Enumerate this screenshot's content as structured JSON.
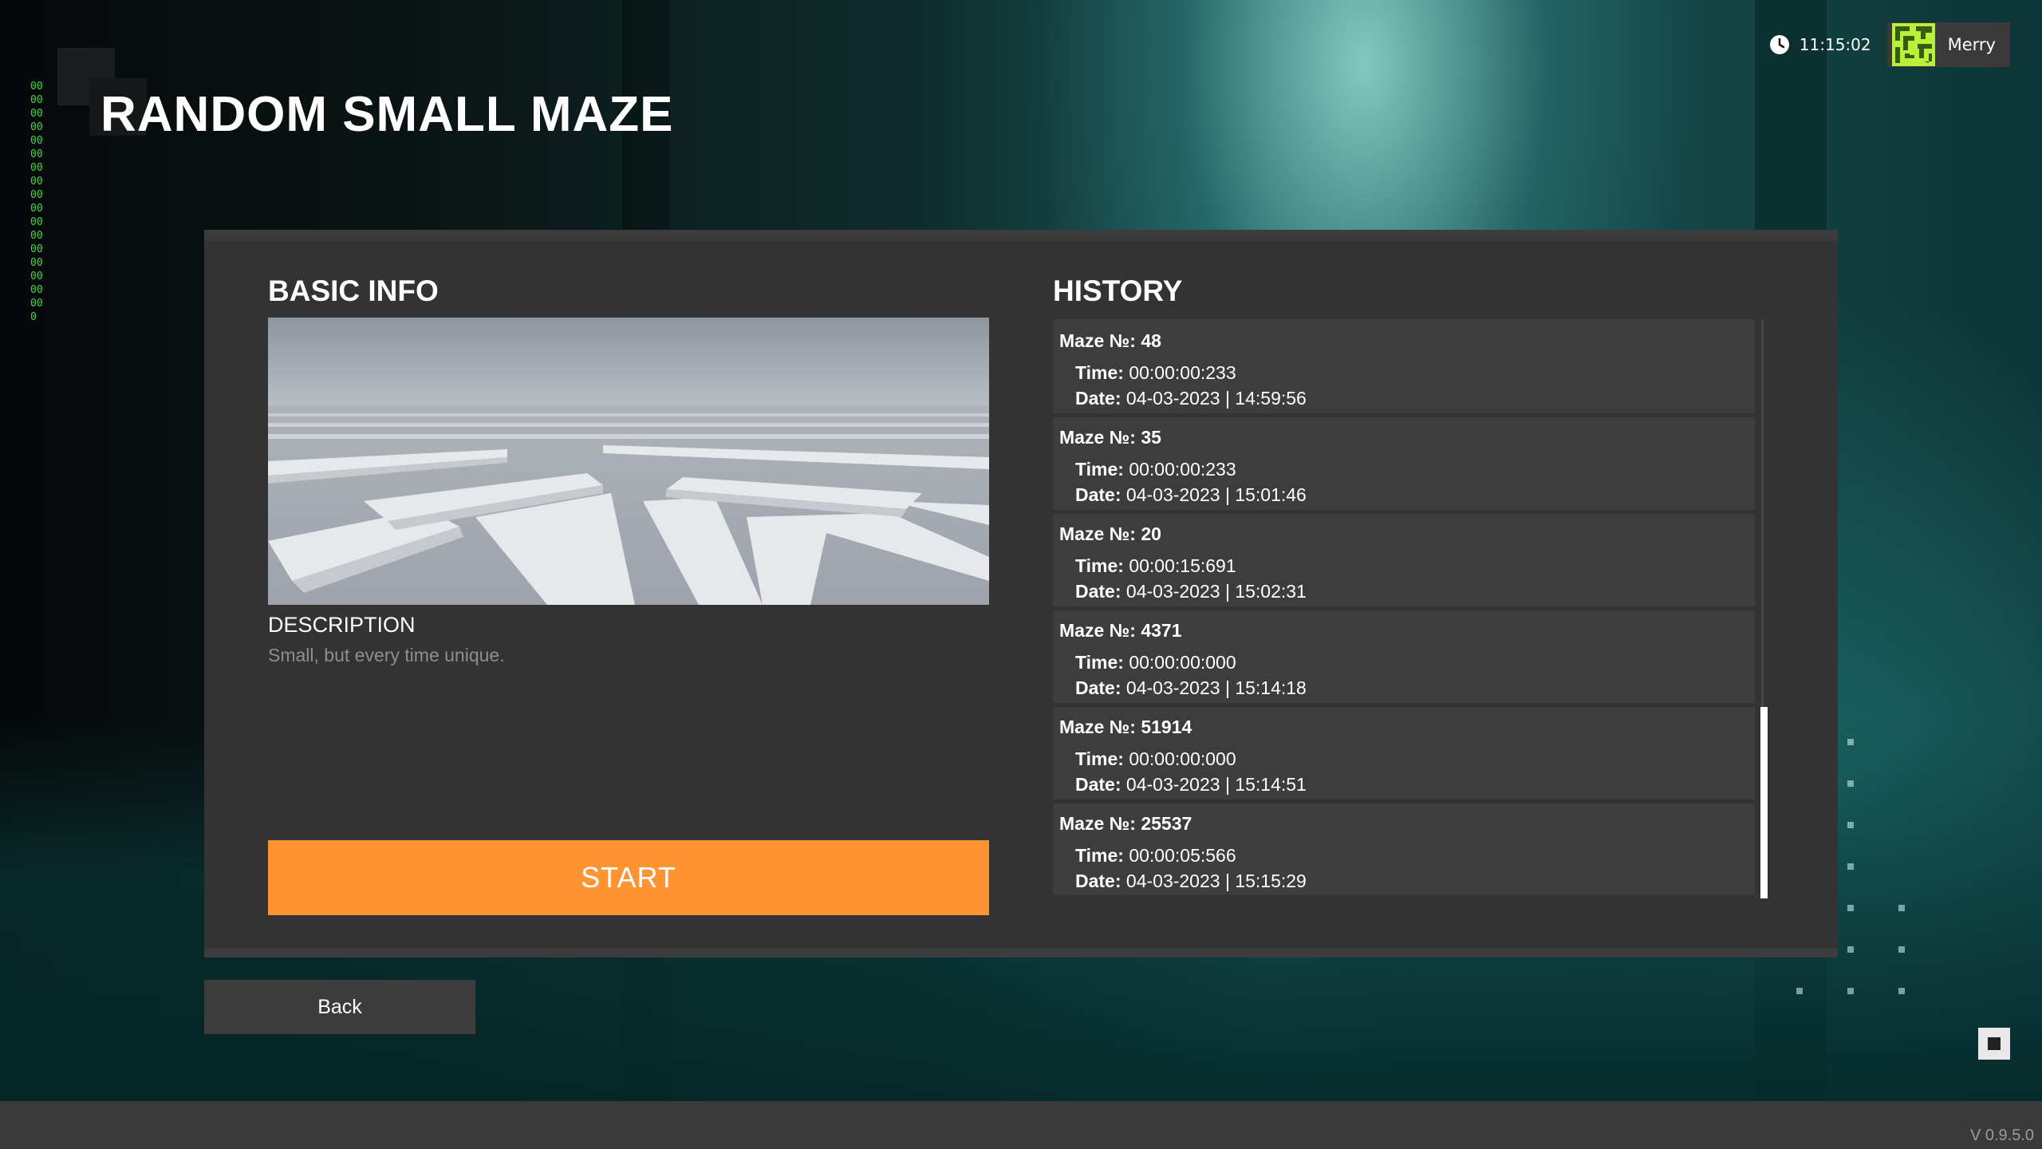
{
  "page": {
    "title": "RANDOM SMALL MAZE",
    "version": "V 0.9.5.0",
    "matrix_digits": "00000000000000000000000000000000000"
  },
  "topbar": {
    "time": "11:15:02",
    "clock_icon": "clock-icon",
    "user_name": "Merry",
    "avatar_color": "#b8f03a"
  },
  "basic_info": {
    "title": "BASIC INFO",
    "description_title": "DESCRIPTION",
    "description": "Small, but every time unique.",
    "start_label": "START",
    "start_color": "#ff9433"
  },
  "history": {
    "title": "HISTORY",
    "maze_label": "Maze №:",
    "time_label": "Time:",
    "date_label": "Date:",
    "items": [
      {
        "maze": "48",
        "time": "00:00:00:233",
        "date": "04-03-2023 | 14:59:56"
      },
      {
        "maze": "35",
        "time": "00:00:00:233",
        "date": "04-03-2023 | 15:01:46"
      },
      {
        "maze": "20",
        "time": "00:00:15:691",
        "date": "04-03-2023 | 15:02:31"
      },
      {
        "maze": "4371",
        "time": "00:00:00:000",
        "date": "04-03-2023 | 15:14:18"
      },
      {
        "maze": "51914",
        "time": "00:00:00:000",
        "date": "04-03-2023 | 15:14:51"
      },
      {
        "maze": "25537",
        "time": "00:00:05:566",
        "date": "04-03-2023 | 15:15:29"
      }
    ]
  },
  "navigation": {
    "back_label": "Back"
  }
}
